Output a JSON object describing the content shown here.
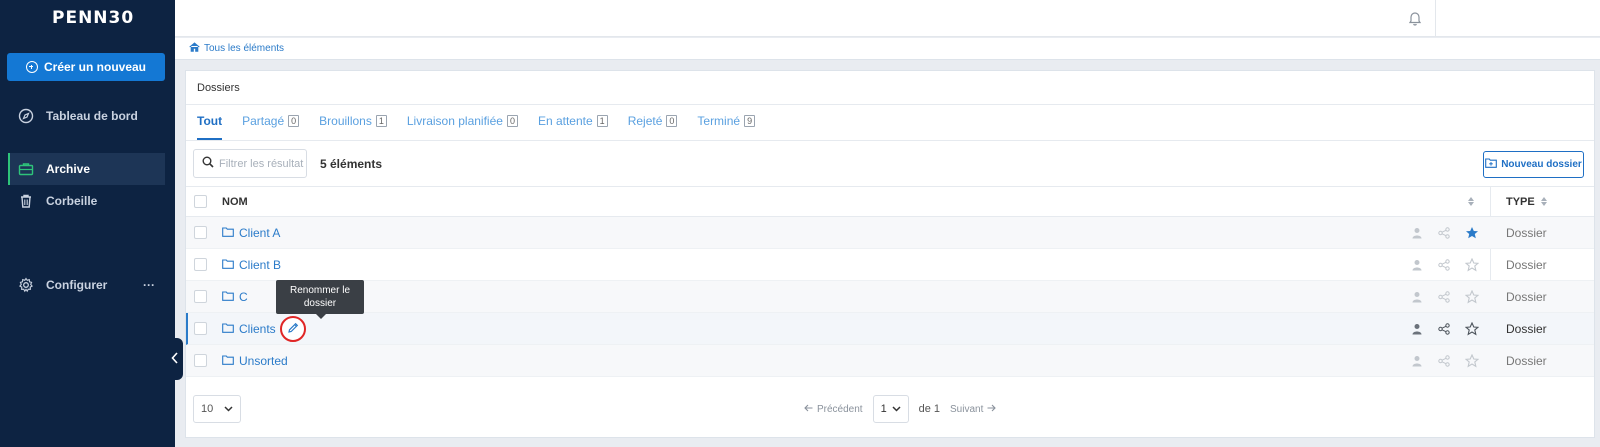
{
  "app": {
    "logo_text": "PENN30"
  },
  "sidebar": {
    "create_label": "Créer un nouveau",
    "items": [
      {
        "label": "Tableau de bord",
        "icon": "compass-icon"
      },
      {
        "label": "Archive",
        "icon": "briefcase-icon",
        "active": true
      },
      {
        "label": "Corbeille",
        "icon": "trash-icon"
      },
      {
        "label": "Configurer",
        "icon": "gear-icon",
        "more": "···"
      }
    ],
    "accent": "#2ec47a"
  },
  "breadcrumb": {
    "label": "Tous les éléments"
  },
  "panel": {
    "title": "Dossiers",
    "tabs": [
      {
        "label": "Tout",
        "count": "",
        "active": true
      },
      {
        "label": "Partagé",
        "count": "0"
      },
      {
        "label": "Brouillons",
        "count": "1"
      },
      {
        "label": "Livraison planifiée",
        "count": "0"
      },
      {
        "label": "En attente",
        "count": "1"
      },
      {
        "label": "Rejeté",
        "count": "0"
      },
      {
        "label": "Terminé",
        "count": "9"
      }
    ],
    "filter_placeholder": "Filtrer les résultat",
    "count_text": "5 éléments",
    "new_folder_label": "Nouveau dossier"
  },
  "table": {
    "headers": {
      "name": "NOM",
      "type": "TYPE"
    },
    "rows": [
      {
        "name": "Client A",
        "type": "Dossier",
        "starred": true
      },
      {
        "name": "Client B",
        "type": "Dossier",
        "starred": false
      },
      {
        "name": "C",
        "type": "Dossier",
        "starred": false
      },
      {
        "name": "Clients",
        "type": "Dossier",
        "starred": false,
        "hover": true
      },
      {
        "name": "Unsorted",
        "type": "Dossier",
        "starred": false
      }
    ],
    "tooltip": "Renommer le dossier"
  },
  "footer": {
    "page_size": "10",
    "prev_label": "Précédent",
    "page": "1",
    "of_text": "de 1",
    "next_label": "Suivant"
  },
  "colors": {
    "primary": "#1478d4",
    "link": "#2b7bc9",
    "star": "#2b7bc9",
    "highlight": "#e02626"
  }
}
